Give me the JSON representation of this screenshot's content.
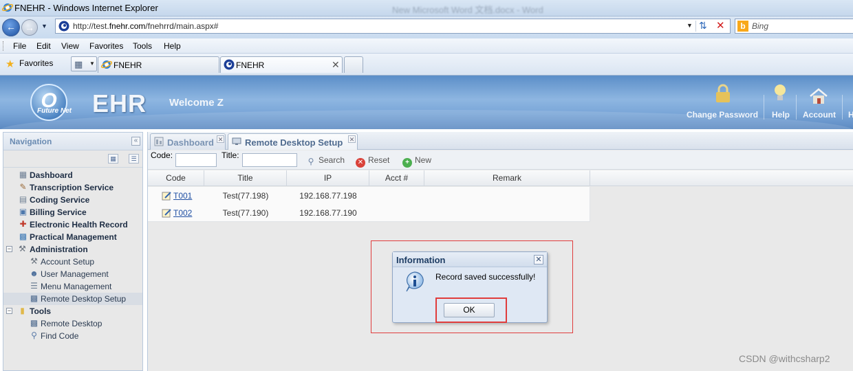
{
  "browser": {
    "window_title": "FNEHR - Windows Internet Explorer",
    "background_window_title": "New Microsoft Word 文档.docx - Word",
    "address_url_prefix": "http://test.",
    "address_url_domain": "fnehr.com",
    "address_url_suffix": "/fnehrrd/main.aspx#",
    "address_ghost": "...",
    "search_placeholder": "Bing",
    "menu": [
      "File",
      "Edit",
      "View",
      "Favorites",
      "Tools",
      "Help"
    ],
    "favorites_label": "Favorites",
    "tabs": [
      {
        "label": "FNEHR",
        "active": false
      },
      {
        "label": "FNEHR",
        "active": true
      }
    ]
  },
  "app": {
    "logo_letter": "O",
    "logo_subtitle": "Future Net",
    "brand": "EHR",
    "welcome": "Welcome Z",
    "header_actions": [
      "Change Password",
      "Help",
      "Account",
      "H"
    ]
  },
  "navigation": {
    "title": "Navigation",
    "items": [
      {
        "label": "Dashboard",
        "icon": "dashboard-icon",
        "level": 0,
        "bold": true
      },
      {
        "label": "Transcription Service",
        "icon": "transcription-icon",
        "level": 0,
        "bold": true
      },
      {
        "label": "Coding Service",
        "icon": "coding-icon",
        "level": 0,
        "bold": true
      },
      {
        "label": "Billing Service",
        "icon": "billing-icon",
        "level": 0,
        "bold": true
      },
      {
        "label": "Electronic Health Record",
        "icon": "health-record-icon",
        "level": 0,
        "bold": true
      },
      {
        "label": "Practical Management",
        "icon": "chart-icon",
        "level": 0,
        "bold": true
      },
      {
        "label": "Administration",
        "icon": "tools-icon",
        "level": 0,
        "bold": true,
        "expanded": true
      },
      {
        "label": "Account Setup",
        "icon": "wrench-icon",
        "level": 1
      },
      {
        "label": "User Management",
        "icon": "user-icon",
        "level": 1
      },
      {
        "label": "Menu Management",
        "icon": "menu-icon",
        "level": 1
      },
      {
        "label": "Remote Desktop Setup",
        "icon": "monitor-icon",
        "level": 1,
        "selected": true
      },
      {
        "label": "Tools",
        "icon": "folder-icon",
        "level": 0,
        "bold": true,
        "expanded": true
      },
      {
        "label": "Remote Desktop",
        "icon": "monitor-icon",
        "level": 1
      },
      {
        "label": "Find Code",
        "icon": "magnifier-icon",
        "level": 1
      }
    ]
  },
  "main": {
    "tabs": [
      {
        "label": "Dashboard"
      },
      {
        "label": "Remote Desktop Setup",
        "active": true
      }
    ],
    "toolbar": {
      "code_label": "Code:",
      "code_value": "",
      "title_label": "Title:",
      "title_value": "",
      "search_label": "Search",
      "reset_label": "Reset",
      "new_label": "New"
    },
    "grid": {
      "columns": [
        "Code",
        "Title",
        "IP",
        "Acct #",
        "Remark"
      ],
      "rows": [
        {
          "code": "T001",
          "title": "Test(77.198)",
          "ip": "192.168.77.198",
          "acct": "",
          "remark": ""
        },
        {
          "code": "T002",
          "title": "Test(77.190)",
          "ip": "192.168.77.190",
          "acct": "",
          "remark": ""
        }
      ]
    }
  },
  "dialog": {
    "title": "Information",
    "message": "Record saved successfully!",
    "ok_label": "OK"
  },
  "watermark": "CSDN @withcsharp2",
  "colors": {
    "header_blue": "#7aa6d8",
    "nav_title": "#6a8bb2",
    "highlight_red": "#e03b3b",
    "link_blue": "#1f4fa3"
  }
}
